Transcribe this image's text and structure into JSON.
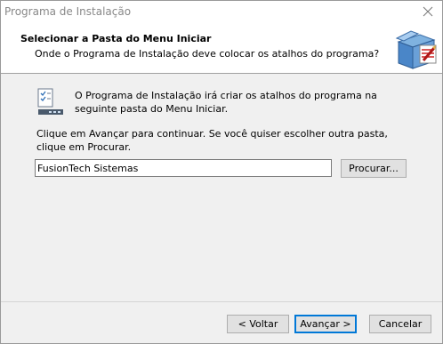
{
  "window": {
    "title": "Programa de Instalação",
    "close_icon": "close-icon"
  },
  "header": {
    "title": "Selecionar a Pasta do Menu Iniciar",
    "subtitle": "Onde o Programa de Instalação deve colocar os atalhos do programa?",
    "icon": "installer-box-icon"
  },
  "content": {
    "icon": "start-menu-folder-icon",
    "description": "O Programa de Instalação irá criar os atalhos do programa na seguinte pasta do Menu Iniciar.",
    "instruction": "Clique em Avançar para continuar. Se você quiser escolher outra pasta, clique em Procurar.",
    "folder_value": "FusionTech Sistemas",
    "browse_label": "Procurar..."
  },
  "footer": {
    "back_label": "< Voltar",
    "next_label": "Avançar >",
    "cancel_label": "Cancelar"
  },
  "colors": {
    "header_background": "#ffffff",
    "body_background": "#f0f0f0",
    "default_button_border": "#0078d7"
  }
}
